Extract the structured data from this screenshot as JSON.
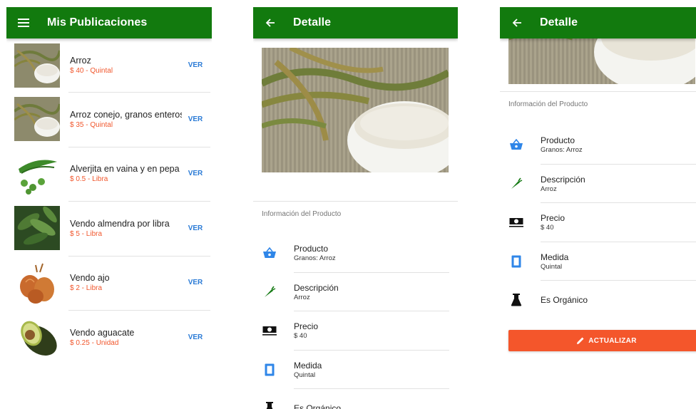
{
  "colors": {
    "app_bar": "#127a0e",
    "price": "#f1572d",
    "link": "#2b7bd6",
    "icon_blue": "#2f86e8",
    "icon_green": "#157a14",
    "button": "#f4562b"
  },
  "screen_list": {
    "title": "Mis Publicaciones",
    "menu_icon": "hamburger-menu-icon",
    "items": [
      {
        "name": "Arroz",
        "price": "$ 40 - Quintal",
        "action": "VER",
        "image": "rice"
      },
      {
        "name": "Arroz conejo, granos enteros",
        "price": "$ 35 - Quintal",
        "action": "VER",
        "image": "rice"
      },
      {
        "name": "Alverjita en vaina y en pepa",
        "price": "$ 0.5 - Libra",
        "action": "VER",
        "image": "peas"
      },
      {
        "name": "Vendo almendra por libra",
        "price": "$ 5 - Libra",
        "action": "VER",
        "image": "almond-leaves"
      },
      {
        "name": "Vendo ajo",
        "price": "$ 2 - Libra",
        "action": "VER",
        "image": "onions"
      },
      {
        "name": "Vendo aguacate",
        "price": "$ 0.25 - Unidad",
        "action": "VER",
        "image": "avocado"
      }
    ]
  },
  "screen_detail": {
    "title": "Detalle",
    "back_icon": "arrow-back-icon",
    "section_label": "Información del Producto",
    "fields": [
      {
        "icon": "basket-icon",
        "label": "Producto",
        "value": "Granos: Arroz"
      },
      {
        "icon": "carrot-icon",
        "label": "Descripción",
        "value": "Arroz"
      },
      {
        "icon": "money-icon",
        "label": "Precio",
        "value": "$ 40"
      },
      {
        "icon": "ruler-icon",
        "label": "Medida",
        "value": "Quintal"
      },
      {
        "icon": "flask-icon",
        "label": "Es Orgánico",
        "value": ""
      }
    ]
  },
  "screen_detail_scrolled": {
    "title": "Detalle",
    "section_label": "Información del Producto",
    "update_button": "ACTUALIZAR"
  }
}
